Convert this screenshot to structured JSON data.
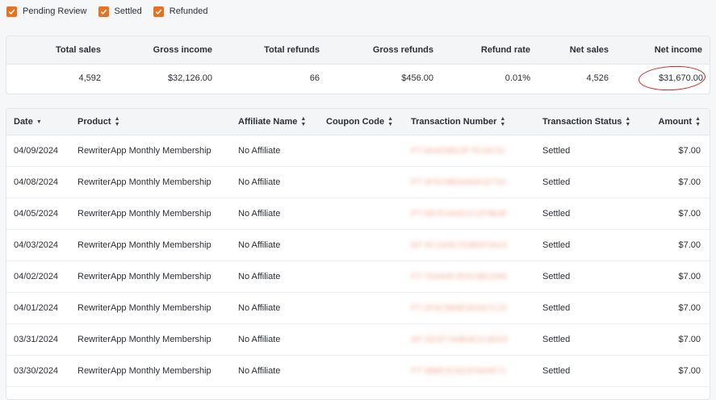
{
  "filters": [
    {
      "label": "Pending Review",
      "checked": true
    },
    {
      "label": "Settled",
      "checked": true
    },
    {
      "label": "Refunded",
      "checked": true
    }
  ],
  "colors": {
    "accent": "#e8711f",
    "annotation": "#d81e1e"
  },
  "summary": {
    "headers": {
      "total_sales": "Total sales",
      "gross_income": "Gross income",
      "total_refunds": "Total refunds",
      "gross_refunds": "Gross refunds",
      "refund_rate": "Refund rate",
      "net_sales": "Net sales",
      "net_income": "Net income"
    },
    "values": {
      "total_sales": "4,592",
      "gross_income": "$32,126.00",
      "total_refunds": "66",
      "gross_refunds": "$456.00",
      "refund_rate": "0.01%",
      "net_sales": "4,526",
      "net_income": "$31,670.00"
    }
  },
  "table": {
    "columns": {
      "date": "Date",
      "product": "Product",
      "affiliate": "Affiliate Name",
      "coupon": "Coupon Code",
      "transaction": "Transaction Number",
      "status": "Transaction Status",
      "amount": "Amount"
    },
    "rows": [
      {
        "date": "04/09/2024",
        "product": "RewriterApp Monthly Membership",
        "affiliate": "No Affiliate",
        "coupon": "",
        "transaction": "PT-8A4D9B23F7E18C51",
        "status": "Settled",
        "amount": "$7.00"
      },
      {
        "date": "04/08/2024",
        "product": "RewriterApp Monthly Membership",
        "affiliate": "No Affiliate",
        "coupon": "",
        "transaction": "PT-3F0C8B5A9D61E720",
        "status": "Settled",
        "amount": "$7.00"
      },
      {
        "date": "04/05/2024",
        "product": "RewriterApp Monthly Membership",
        "affiliate": "No Affiliate",
        "coupon": "",
        "transaction": "PT-5B7E4A0D1C2F9B38",
        "status": "Settled",
        "amount": "$7.00"
      },
      {
        "date": "04/03/2024",
        "product": "RewriterApp Monthly Membership",
        "affiliate": "No Affiliate",
        "coupon": "",
        "transaction": "AP-9C1A6E7D3B5F0A24",
        "status": "Settled",
        "amount": "$7.00"
      },
      {
        "date": "04/02/2024",
        "product": "RewriterApp Monthly Membership",
        "affiliate": "No Affiliate",
        "coupon": "",
        "transaction": "PT-7D4A0F2E5C8B1D96",
        "status": "Settled",
        "amount": "$7.00"
      },
      {
        "date": "04/01/2024",
        "product": "RewriterApp Monthly Membership",
        "affiliate": "No Affiliate",
        "coupon": "",
        "transaction": "PT-2F6C9B8E0D3A7C15",
        "status": "Settled",
        "amount": "$7.00"
      },
      {
        "date": "03/31/2024",
        "product": "RewriterApp Monthly Membership",
        "affiliate": "No Affiliate",
        "coupon": "",
        "transaction": "AP-5D2F7A9B4E1C8D03",
        "status": "Settled",
        "amount": "$7.00"
      },
      {
        "date": "03/30/2024",
        "product": "RewriterApp Monthly Membership",
        "affiliate": "No Affiliate",
        "coupon": "",
        "transaction": "PT-0B8E3C6D2F9A5E71",
        "status": "Settled",
        "amount": "$7.00"
      }
    ]
  }
}
